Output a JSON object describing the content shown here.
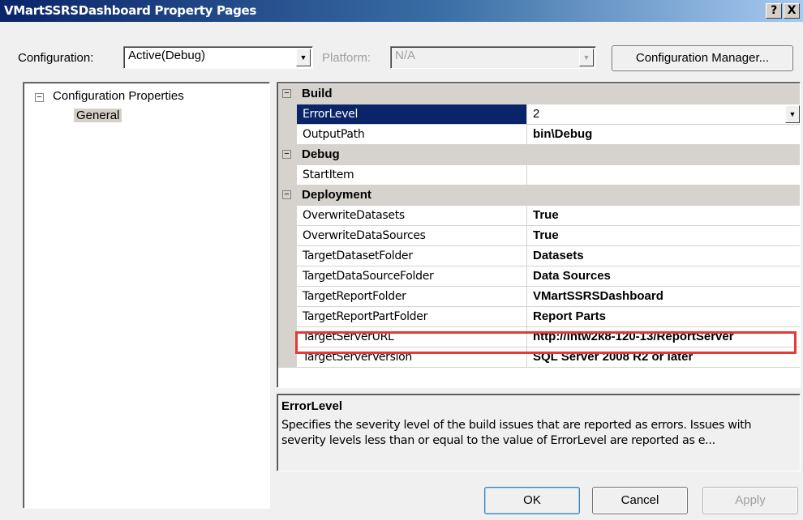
{
  "window": {
    "title": "VMartSSRSDashboard Property Pages",
    "help_button": "?",
    "close_button": "X"
  },
  "config_bar": {
    "configuration_label": "Configuration:",
    "configuration_value": "Active(Debug)",
    "platform_label": "Platform:",
    "platform_value": "N/A",
    "config_manager_button": "Configuration Manager..."
  },
  "tree": {
    "root": "Configuration Properties",
    "child": "General"
  },
  "grid": {
    "categories": {
      "build": "Build",
      "debug": "Debug",
      "deployment": "Deployment"
    },
    "properties": [
      {
        "name": "ErrorLevel",
        "value": "2"
      },
      {
        "name": "OutputPath",
        "value": "bin\\Debug"
      },
      {
        "name": "StartItem",
        "value": ""
      },
      {
        "name": "OverwriteDatasets",
        "value": "True"
      },
      {
        "name": "OverwriteDataSources",
        "value": "True"
      },
      {
        "name": "TargetDatasetFolder",
        "value": "Datasets"
      },
      {
        "name": "TargetDataSourceFolder",
        "value": "Data Sources"
      },
      {
        "name": "TargetReportFolder",
        "value": "VMartSSRSDashboard"
      },
      {
        "name": "TargetReportPartFolder",
        "value": "Report Parts"
      },
      {
        "name": "TargetServerURL",
        "value": "http://intw2k8-120-13/ReportServer"
      },
      {
        "name": "TargetServerVersion",
        "value": "SQL Server 2008 R2 or later"
      }
    ]
  },
  "description": {
    "title": "ErrorLevel",
    "text": "Specifies the severity level of the build issues that are reported as errors. Issues with severity levels less than or equal to the value of ErrorLevel are reported as e..."
  },
  "buttons": {
    "ok": "OK",
    "cancel": "Cancel",
    "apply": "Apply"
  },
  "colors": {
    "selection": "#0a246a",
    "highlight_box": "#e53a35"
  }
}
